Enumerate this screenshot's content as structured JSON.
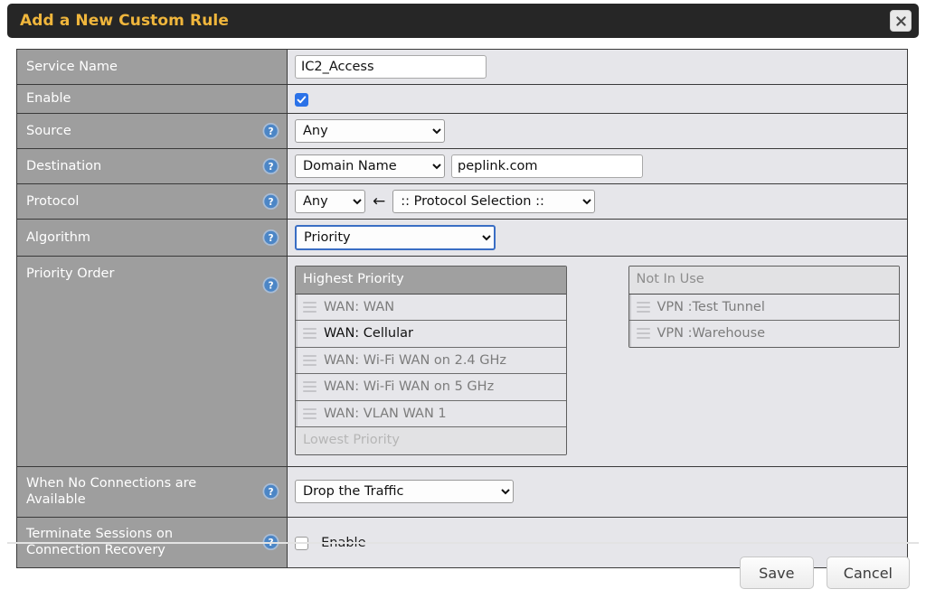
{
  "dialog": {
    "title": "Add a New Custom Rule",
    "close_icon": "close-icon",
    "close_glyph": "✖",
    "accent_title_color": "#f0b63c",
    "titlebar_color": "#262626",
    "label_column_color": "#9e9e9e",
    "value_column_color": "#e6e6ea"
  },
  "rows": {
    "service_name": {
      "label": "Service Name",
      "value": "IC2_Access",
      "placeholder": ""
    },
    "enable": {
      "label": "Enable",
      "checked": true
    },
    "source": {
      "label": "Source",
      "help_icon": "help-icon",
      "selected": "Any",
      "options": [
        "Any"
      ]
    },
    "destination": {
      "label": "Destination",
      "help_icon": "help-icon",
      "type_selected": "Domain Name",
      "type_options": [
        "Domain Name"
      ],
      "value": "peplink.com",
      "placeholder": ""
    },
    "protocol": {
      "label": "Protocol",
      "help_icon": "help-icon",
      "selected": "Any",
      "options": [
        "Any"
      ],
      "arrow": "←",
      "selection_selected": ":: Protocol Selection ::",
      "selection_options": [
        ":: Protocol Selection ::"
      ]
    },
    "algorithm": {
      "label": "Algorithm",
      "help_icon": "help-icon",
      "selected": "Priority",
      "options": [
        "Priority"
      ],
      "focused": true,
      "focus_color": "#3a6ec4"
    },
    "priority_order": {
      "label": "Priority Order",
      "help_icon": "help-icon",
      "in_use": {
        "header": "Highest Priority",
        "footer": "Lowest Priority",
        "items": [
          {
            "label": "WAN: WAN",
            "active": false,
            "handle_icon": "drag-handle-icon"
          },
          {
            "label": "WAN: Cellular",
            "active": true,
            "handle_icon": "drag-handle-icon"
          },
          {
            "label": "WAN: Wi-Fi WAN on 2.4 GHz",
            "active": false,
            "handle_icon": "drag-handle-icon"
          },
          {
            "label": "WAN: Wi-Fi WAN on 5 GHz",
            "active": false,
            "handle_icon": "drag-handle-icon"
          },
          {
            "label": "WAN: VLAN WAN 1",
            "active": false,
            "handle_icon": "drag-handle-icon"
          }
        ]
      },
      "not_in_use": {
        "header": "Not In Use",
        "items": [
          {
            "label": "VPN :Test Tunnel",
            "active": false,
            "handle_icon": "drag-handle-icon"
          },
          {
            "label": "VPN :Warehouse",
            "active": false,
            "handle_icon": "drag-handle-icon"
          }
        ]
      }
    },
    "no_connections": {
      "label": "When No Connections are Available",
      "help_icon": "help-icon",
      "selected": "Drop the Traffic",
      "options": [
        "Drop the Traffic"
      ]
    },
    "terminate_sessions": {
      "label": "Terminate Sessions on Connection Recovery",
      "help_icon": "help-icon",
      "checkbox_label": "Enable",
      "checked": false
    }
  },
  "footer": {
    "save_label": "Save",
    "cancel_label": "Cancel"
  }
}
